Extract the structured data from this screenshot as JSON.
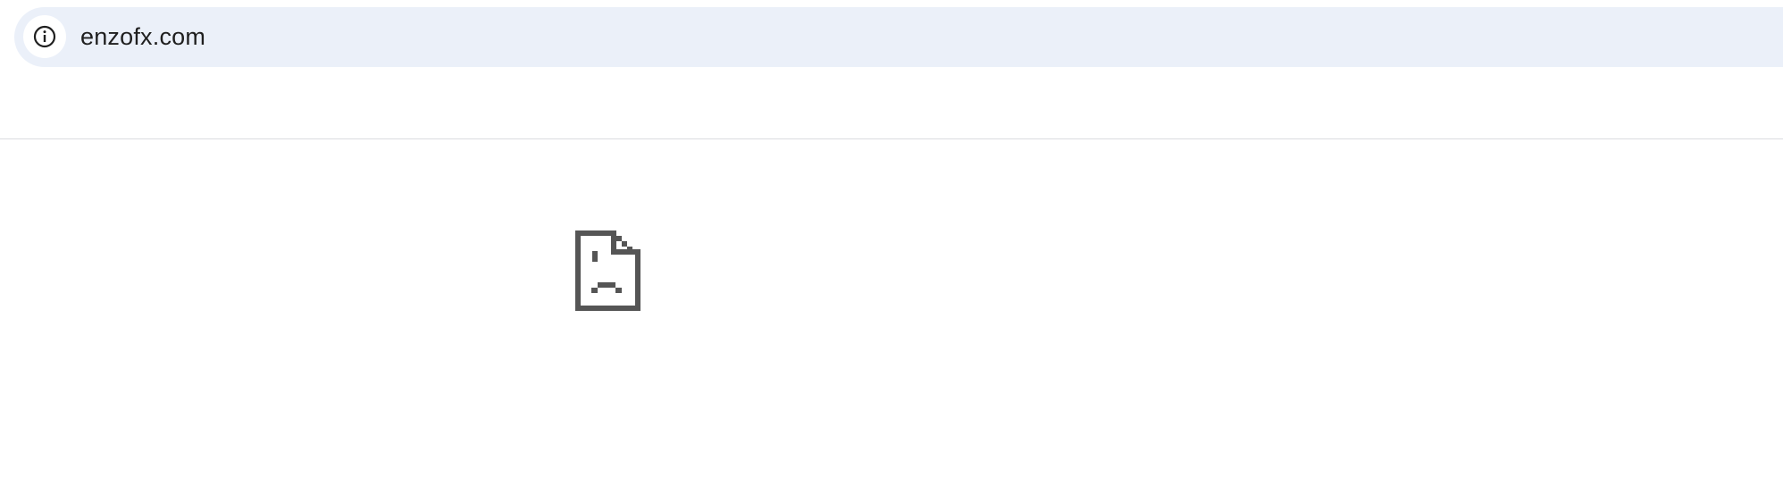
{
  "address_bar": {
    "url": "enzofx.com",
    "site_info_icon": "info-icon"
  },
  "error_page": {
    "icon": "sad-page-icon"
  },
  "colors": {
    "omnibox_background": "#ebf0f9",
    "icon": "#555555",
    "text": "#1f1f1f"
  }
}
